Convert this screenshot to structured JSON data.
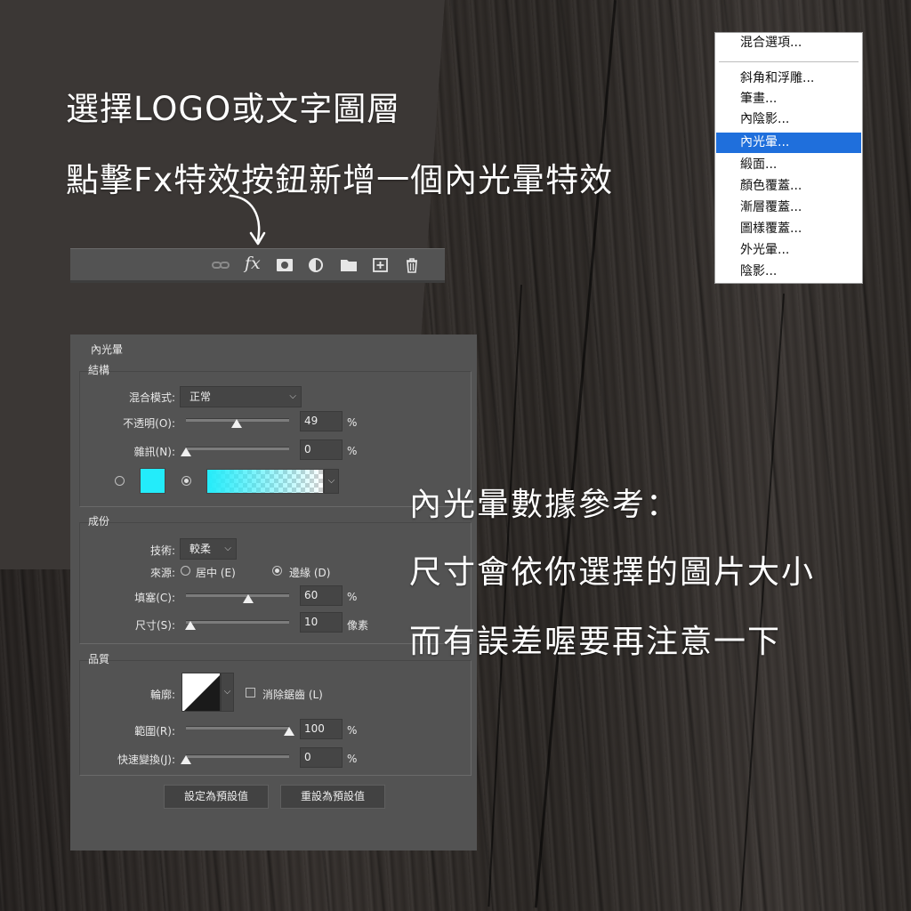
{
  "headline": {
    "line1": "選擇LOGO或文字圖層",
    "line2": "點擊Fx特效按鈕新增一個內光暈特效"
  },
  "toolbar": {
    "icons": [
      "link-icon",
      "fx-icon",
      "mask-icon",
      "adjustment-icon",
      "folder-icon",
      "new-layer-icon",
      "trash-icon"
    ],
    "fx_label": "fx"
  },
  "menu": {
    "items": [
      "混合選項...",
      "斜角和浮雕...",
      "筆畫...",
      "內陰影...",
      "內光暈...",
      "緞面...",
      "顏色覆蓋...",
      "漸層覆蓋...",
      "圖樣覆蓋...",
      "外光暈...",
      "陰影..."
    ],
    "active_item": "內光暈...",
    "active_color": "#1f6fdc"
  },
  "dialog": {
    "title": "內光暈",
    "structure": {
      "title": "結構",
      "blend_mode_label": "混合模式:",
      "blend_mode_value": "正常",
      "opacity_label": "不透明(O):",
      "opacity_value": "49",
      "opacity_unit": "%",
      "opacity": 49,
      "noise_label": "雜訊(N):",
      "noise_value": "0",
      "noise_unit": "%",
      "noise": 0,
      "glow_color": "#23ecfa"
    },
    "elements": {
      "title": "成份",
      "technique_label": "技術:",
      "technique_value": "較柔",
      "source_label": "來源:",
      "source_center": "居中 (E)",
      "source_edge": "邊緣 (D)",
      "choke_label": "填塞(C):",
      "choke_value": "60",
      "choke_unit": "%",
      "choke": 60,
      "size_label": "尺寸(S):",
      "size_value": "10",
      "size_unit": "像素",
      "size": 10
    },
    "quality": {
      "title": "品質",
      "contour_label": "輪廓:",
      "anti_alias_label": "消除鋸齒 (L)",
      "range_label": "範圍(R):",
      "range_value": "100",
      "range_unit": "%",
      "range": 100,
      "jitter_label": "快速變換(J):",
      "jitter_value": "0",
      "jitter_unit": "%",
      "jitter": 0
    },
    "make_default_button": "設定為預設值",
    "reset_default_button": "重設為預設值"
  },
  "note": {
    "line1": "內光暈數據參考：",
    "line2": "尺寸會依你選擇的圖片大小",
    "line3": "而有誤差喔要再注意一下"
  }
}
